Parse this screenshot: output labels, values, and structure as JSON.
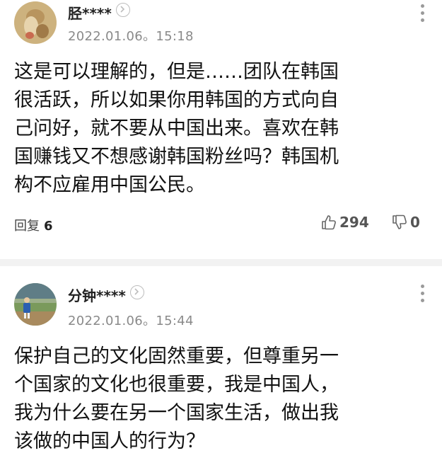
{
  "comments": [
    {
      "username": "胫****",
      "timestamp": "2022.01.06。15:18",
      "lines": [
        "这是可以理解的，但是……团队在韩国",
        "很活跃，所以如果你用韩国的方式向自",
        "己问好，就不要从中国出来。喜欢在韩",
        "国赚钱又不想感谢韩国粉丝吗？韩国机",
        "构不应雇用中国公民。"
      ],
      "reply_label": "回复",
      "reply_count": "6",
      "like_count": "294",
      "dislike_count": "0"
    },
    {
      "username": "分钟****",
      "timestamp": "2022.01.06。15:44",
      "lines": [
        "保护自己的文化固然重要，但尊重另一",
        "个国家的文化也很重要，我是中国人，",
        "我为什么要在另一个国家生活，做出我",
        "该做的中国人的行为？"
      ]
    }
  ],
  "icons": {
    "profile_chevron": "chevron-right-icon",
    "more": "more-vertical-icon",
    "like": "thumbs-up-icon",
    "dislike": "thumbs-down-icon"
  },
  "colors": {
    "text": "#111111",
    "meta": "#8a8a8a",
    "divider": "#f2f2f2"
  }
}
